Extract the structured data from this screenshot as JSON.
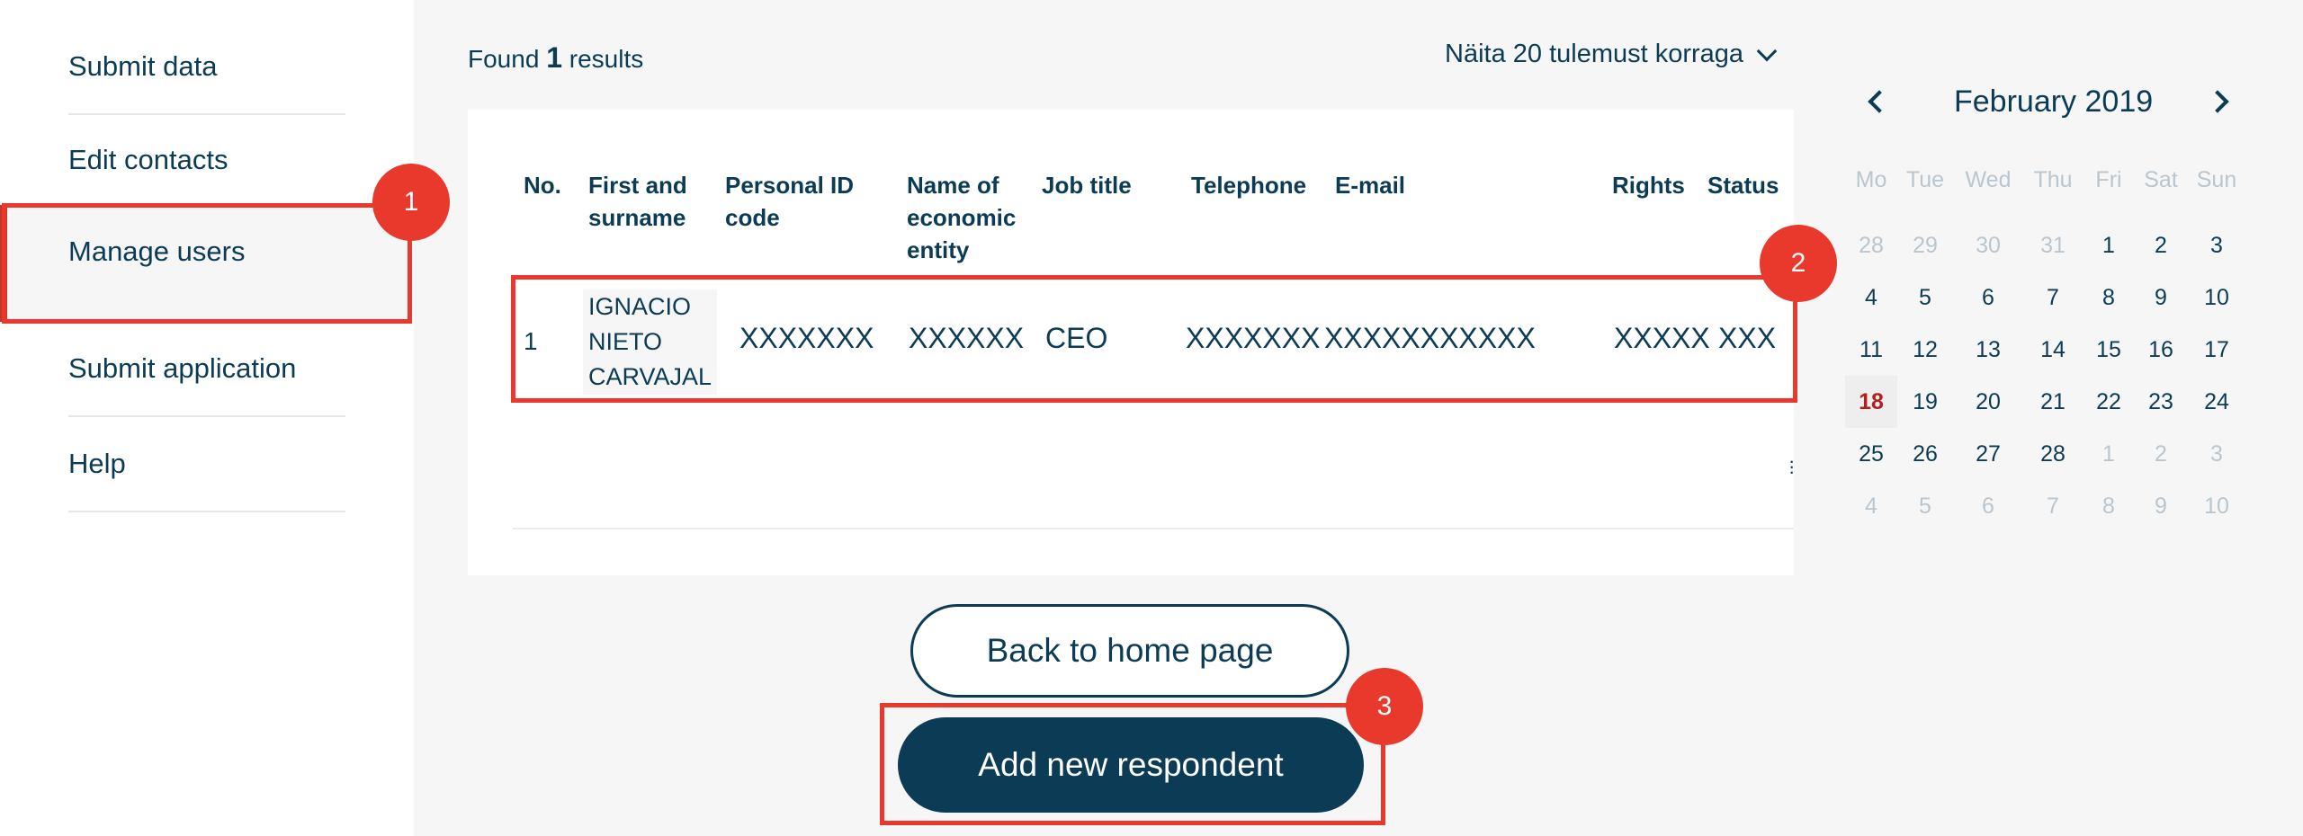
{
  "sidebar": {
    "items": [
      {
        "label": "Submit data"
      },
      {
        "label": "Edit contacts"
      },
      {
        "label": "Manage users",
        "active": true
      },
      {
        "label": "Submit application"
      },
      {
        "label": "Help"
      }
    ]
  },
  "annotations": {
    "badge1": "1",
    "badge2": "2",
    "badge3": "3"
  },
  "results": {
    "found_prefix": "Found",
    "found_count": "1",
    "found_suffix": "results",
    "page_size_label": "Näita 20 tulemust korraga"
  },
  "table": {
    "headers": {
      "no": "No.",
      "name": [
        "First and",
        "surname"
      ],
      "personal_id": [
        "Personal ID",
        "code"
      ],
      "entity": [
        "Name of",
        "economic",
        "entity"
      ],
      "job_title": "Job title",
      "telephone": "Telephone",
      "email": "E-mail",
      "rights": "Rights",
      "status": "Status"
    },
    "rows": [
      {
        "no": "1",
        "name": [
          "IGNACIO",
          "NIETO",
          "CARVAJAL"
        ],
        "personal_id": "XXXXXXX",
        "entity": "XXXXXX",
        "job_title": "CEO",
        "telephone": "XXXXXXX",
        "email": "XXXXXXXXXXX",
        "rights": "XXXXX",
        "status": "XXX"
      }
    ]
  },
  "buttons": {
    "back": "Back to home page",
    "add": "Add new respondent"
  },
  "calendar": {
    "title": "February 2019",
    "weekdays": [
      "Mo",
      "Tue",
      "Wed",
      "Thu",
      "Fri",
      "Sat",
      "Sun"
    ],
    "weeks": [
      [
        "28",
        "29",
        "30",
        "31",
        "1",
        "2",
        "3"
      ],
      [
        "4",
        "5",
        "6",
        "7",
        "8",
        "9",
        "10"
      ],
      [
        "11",
        "12",
        "13",
        "14",
        "15",
        "16",
        "17"
      ],
      [
        "18",
        "19",
        "20",
        "21",
        "22",
        "23",
        "24"
      ],
      [
        "25",
        "26",
        "27",
        "28",
        "1",
        "2",
        "3"
      ],
      [
        "4",
        "5",
        "6",
        "7",
        "8",
        "9",
        "10"
      ]
    ],
    "today": "18",
    "colors": {
      "accent": "#0b3b55",
      "today": "#b21f1f",
      "annotation": "#e8392c"
    }
  }
}
